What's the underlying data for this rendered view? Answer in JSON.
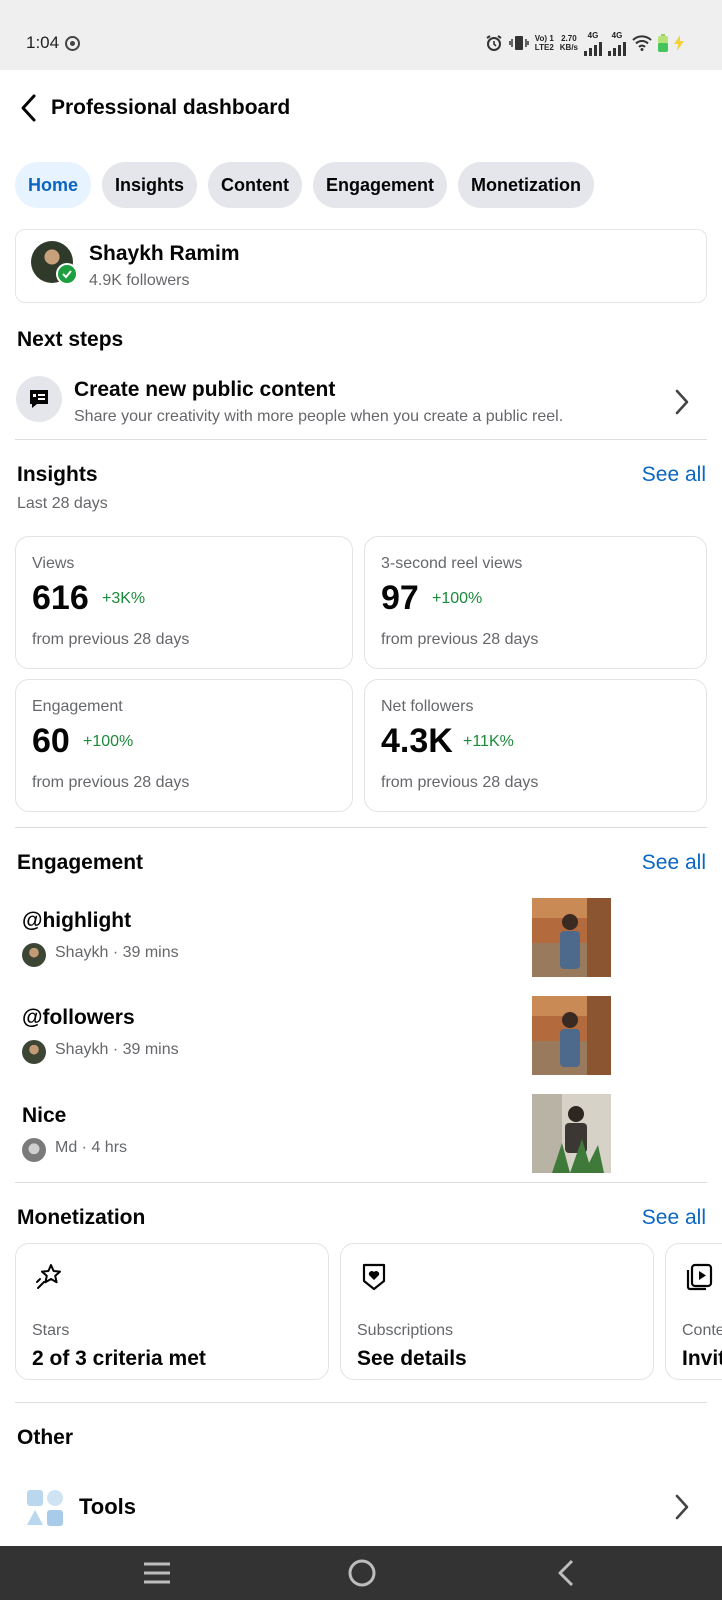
{
  "status_bar": {
    "time": "1:04",
    "network_label_top": "Vo) 1",
    "network_label_bottom": "LTE2",
    "speed_top": "2.70",
    "speed_bottom": "KB/s",
    "sim1": "4G",
    "sim2": "4G"
  },
  "header": {
    "title": "Professional dashboard"
  },
  "tabs": [
    {
      "label": "Home",
      "active": true
    },
    {
      "label": "Insights"
    },
    {
      "label": "Content"
    },
    {
      "label": "Engagement"
    },
    {
      "label": "Monetization"
    }
  ],
  "profile": {
    "name": "Shaykh Ramim",
    "followers": "4.9K followers"
  },
  "next_steps": {
    "title": "Next steps",
    "item": {
      "title": "Create new public content",
      "subtitle": "Share your creativity with more people when you create a public reel."
    }
  },
  "insights": {
    "title": "Insights",
    "see_all": "See all",
    "period": "Last 28 days",
    "cards": [
      {
        "label": "Views",
        "value": "616",
        "change": "+3K%",
        "foot": "from previous 28 days"
      },
      {
        "label": "3-second reel views",
        "value": "97",
        "change": "+100%",
        "foot": "from previous 28 days"
      },
      {
        "label": "Engagement",
        "value": "60",
        "change": "+100%",
        "foot": "from previous 28 days"
      },
      {
        "label": "Net followers",
        "value": "4.3K",
        "change": "+11K%",
        "foot": "from previous 28 days"
      }
    ]
  },
  "engagement": {
    "title": "Engagement",
    "see_all": "See all",
    "items": [
      {
        "title": "@highlight",
        "meta": "Shaykh · 39 mins"
      },
      {
        "title": "@followers",
        "meta": "Shaykh · 39 mins"
      },
      {
        "title": "Nice",
        "meta": "Md · 4 hrs"
      }
    ]
  },
  "monetization": {
    "title": "Monetization",
    "see_all": "See all",
    "cards": [
      {
        "label": "Stars",
        "value": "2 of 3 criteria met",
        "icon": "stars-icon"
      },
      {
        "label": "Subscriptions",
        "value": "See details",
        "icon": "subscriptions-icon"
      },
      {
        "label": "Conte",
        "value": "Invit",
        "icon": "content-icon"
      }
    ]
  },
  "other": {
    "title": "Other",
    "tools_label": "Tools"
  },
  "colors": {
    "accent": "#0a66c2",
    "positive": "#1b8a3a",
    "verified": "#1e9e3e"
  }
}
